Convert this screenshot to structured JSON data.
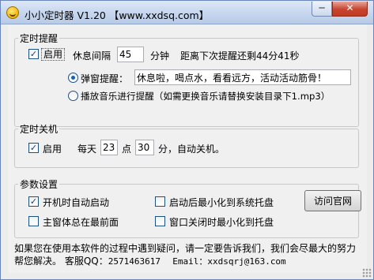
{
  "window": {
    "title": "小小定时器 V1.20 【www.xxdsq.com】",
    "minimize_glyph": "─",
    "close_glyph": "✕"
  },
  "reminder": {
    "legend": "定时提醒",
    "enable_label": "启用",
    "enabled": true,
    "interval_label": "休息间隔",
    "interval_value": "45",
    "interval_unit": "分钟",
    "countdown_text": "距离下次提醒还剩44分41秒",
    "popup_label": "弹窗提醒：",
    "popup_selected": true,
    "popup_message": "休息啦，喝点水，看看远方，活动活动筋骨！",
    "music_label": "播放音乐进行提醒（如需更换音乐请替换安装目录下1.mp3）",
    "music_selected": false
  },
  "shutdown": {
    "legend": "定时关机",
    "enable_label": "启用",
    "enabled": true,
    "daily_label": "每天",
    "hour_value": "23",
    "hour_unit": "点",
    "minute_value": "30",
    "minute_suffix": "分，自动关机。"
  },
  "settings": {
    "legend": "参数设置",
    "autostart_label": "开机时自动启动",
    "autostart_checked": true,
    "minimize_tray_label": "启动后最小化到系统托盘",
    "minimize_tray_checked": false,
    "always_top_label": "主窗体总在最前面",
    "always_top_checked": false,
    "close_tray_label": "窗口关闭时最小化到托盘",
    "close_tray_checked": false,
    "visit_button": "访问官网"
  },
  "footer": {
    "line1": "如果您在使用本软件的过程中遇到疑问，请一定要告诉我们，我们会尽最大的努力",
    "line2_prefix": "帮您解决。 客服QQ：",
    "qq": "2571463617",
    "email_label": "Email：",
    "email": "xxdsqrj@163.com"
  },
  "check_glyph": "✓",
  "colors": {
    "title_bar": "#c6d6ee",
    "close_button": "#c7442f",
    "background": "#f0f0f0"
  }
}
